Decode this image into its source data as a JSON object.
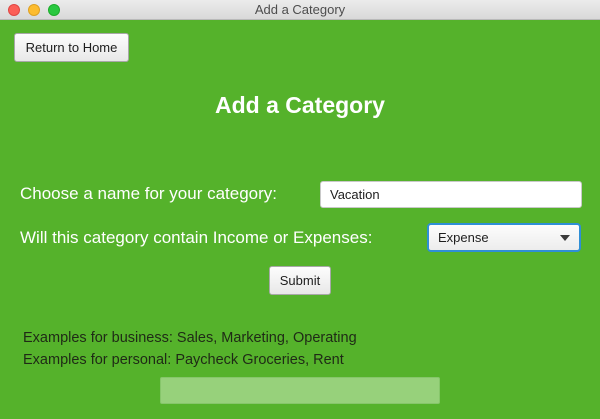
{
  "window": {
    "title": "Add a Category",
    "accent_color": "#55b22b"
  },
  "toolbar": {
    "home_label": "Return to Home"
  },
  "main": {
    "heading": "Add a Category",
    "name_prompt": "Choose a name for your category:",
    "name_value": "Vacation",
    "type_prompt": "Will this category contain Income or Expenses:",
    "type_selected": "Expense",
    "submit_label": "Submit",
    "examples": {
      "business": "Examples for business: Sales, Marketing, Operating",
      "personal": "Examples for personal: Paycheck Groceries, Rent"
    }
  },
  "icons": {
    "close": "close-icon",
    "minimize": "minimize-icon",
    "zoom": "zoom-icon",
    "dropdown": "chevron-down-icon"
  }
}
